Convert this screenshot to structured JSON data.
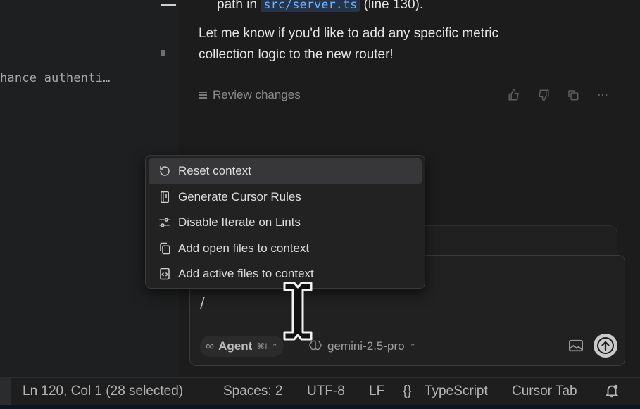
{
  "editor": {
    "truncated_text": "hance authenti…"
  },
  "chat": {
    "line0_prefix": "path in",
    "line0_code": "src/server.ts",
    "line0_suffix": "(line 130).",
    "line1": "Let me know if you'd like to add any specific metric",
    "line2": "collection logic to the new router!",
    "review_label": "Review changes"
  },
  "menu": {
    "items": [
      {
        "label": "Reset context",
        "icon": "reset-icon"
      },
      {
        "label": "Generate Cursor Rules",
        "icon": "rules-file-icon"
      },
      {
        "label": "Disable Iterate on Lints",
        "icon": "sliders-icon"
      },
      {
        "label": "Add open files to context",
        "icon": "copy-files-icon"
      },
      {
        "label": "Add active files to context",
        "icon": "code-file-icon"
      }
    ]
  },
  "composer": {
    "input_value": "/",
    "mode_label": "Agent",
    "mode_shortcut": "⌘I",
    "model_label": "gemini-2.5-pro"
  },
  "status_bar": {
    "position": "Ln 120, Col 1 (28 selected)",
    "spaces": "Spaces: 2",
    "encoding": "UTF-8",
    "eol": "LF",
    "braces": "{}",
    "language": "TypeScript",
    "cursor_tab": "Cursor Tab"
  }
}
